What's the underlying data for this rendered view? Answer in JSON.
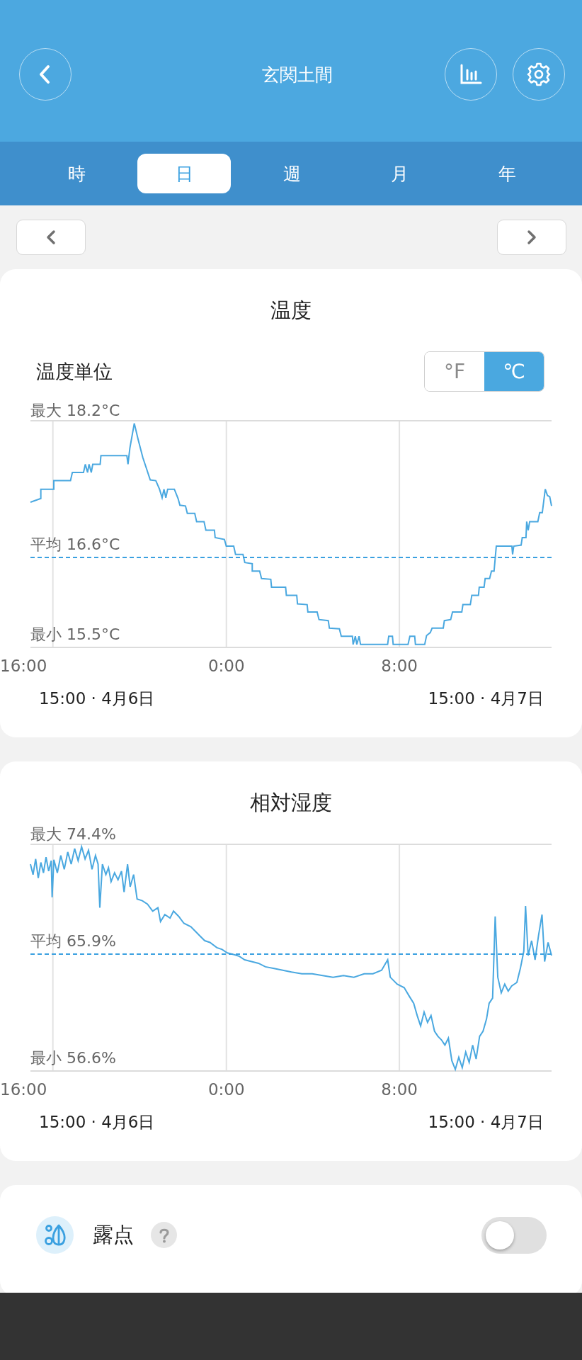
{
  "header": {
    "title": "玄関土間"
  },
  "tabs": [
    {
      "label": "時",
      "selected": false
    },
    {
      "label": "日",
      "selected": true
    },
    {
      "label": "週",
      "selected": false
    },
    {
      "label": "月",
      "selected": false
    },
    {
      "label": "年",
      "selected": false
    }
  ],
  "charts": [
    {
      "kind": "temperature",
      "title": "温度",
      "unit_label": "温度単位",
      "units": [
        {
          "label": "°F",
          "selected": false
        },
        {
          "label": "℃",
          "selected": true
        }
      ],
      "max": "最大 18.2°C",
      "average": "平均 16.6°C",
      "min": "最小 15.5°C",
      "time_labels": [
        "16:00",
        "0:00",
        "8:00"
      ],
      "start": "15:00 · 4月6日",
      "end": "15:00 · 4月7日"
    },
    {
      "kind": "humidity",
      "title": "相対湿度",
      "max": "最大 74.4%",
      "average": "平均 65.9%",
      "min": "最小 56.6%",
      "time_labels": [
        "16:00",
        "0:00",
        "8:00"
      ],
      "start": "15:00 · 4月6日",
      "end": "15:00 · 4月7日"
    }
  ],
  "dew_point": {
    "label": "露点",
    "on": false
  }
}
